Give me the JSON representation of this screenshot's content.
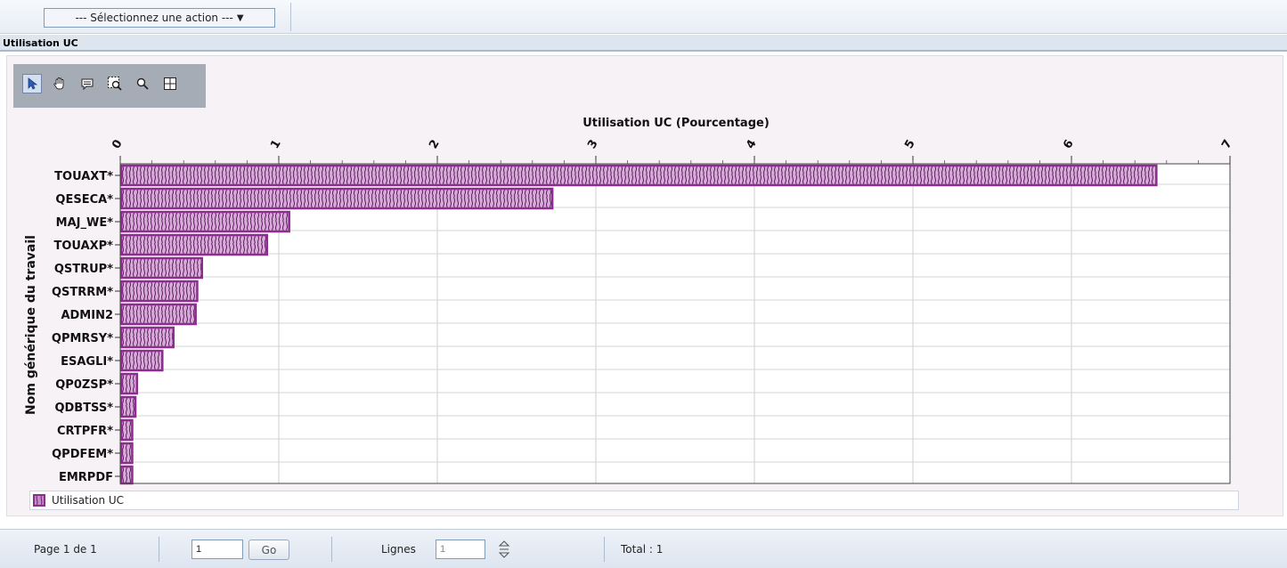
{
  "toolbar": {
    "action_select_label": "--- Sélectionnez une action ---",
    "action_select_arrow": "▼"
  },
  "section": {
    "title": "Utilisation UC"
  },
  "chart_tools": [
    "select-tool",
    "pan-tool",
    "annotate-tool",
    "zoom-rect-tool",
    "zoom-tool",
    "crosshair-tool"
  ],
  "chart_data": {
    "type": "bar",
    "orientation": "horizontal",
    "title": "Utilisation UC (Pourcentage)",
    "xlabel": "Utilisation UC (Pourcentage)",
    "ylabel": "Nom générique du travail",
    "xlim": [
      0,
      7
    ],
    "xticks": [
      "0",
      "1",
      "2",
      "3",
      "4",
      "5",
      "6",
      "7"
    ],
    "grid": true,
    "legend_position": "bottom",
    "categories": [
      "TOUAXT*",
      "QESECA*",
      "MAJ_WE*",
      "TOUAXP*",
      "QSTRUP*",
      "QSTRRM*",
      "ADMIN2",
      "QPMRSY*",
      "ESAGLI*",
      "QP0ZSP*",
      "QDBTSS*",
      "CRTPFR*",
      "QPDFEM*",
      "EMRPDF"
    ],
    "series": [
      {
        "name": "Utilisation UC",
        "values": [
          6.53,
          2.72,
          1.06,
          0.92,
          0.51,
          0.48,
          0.47,
          0.33,
          0.26,
          0.1,
          0.09,
          0.07,
          0.07,
          0.07
        ]
      }
    ],
    "colors": {
      "bar_border": "#8b2e8d",
      "bar_fill": "#c38cc5",
      "bar_pattern": "#6e2470"
    }
  },
  "footer": {
    "page_label": "Page 1 de 1",
    "page_input_value": "1",
    "go_label": "Go",
    "lines_label": "Lignes",
    "lines_input_value": "1",
    "total_label": "Total : 1"
  }
}
